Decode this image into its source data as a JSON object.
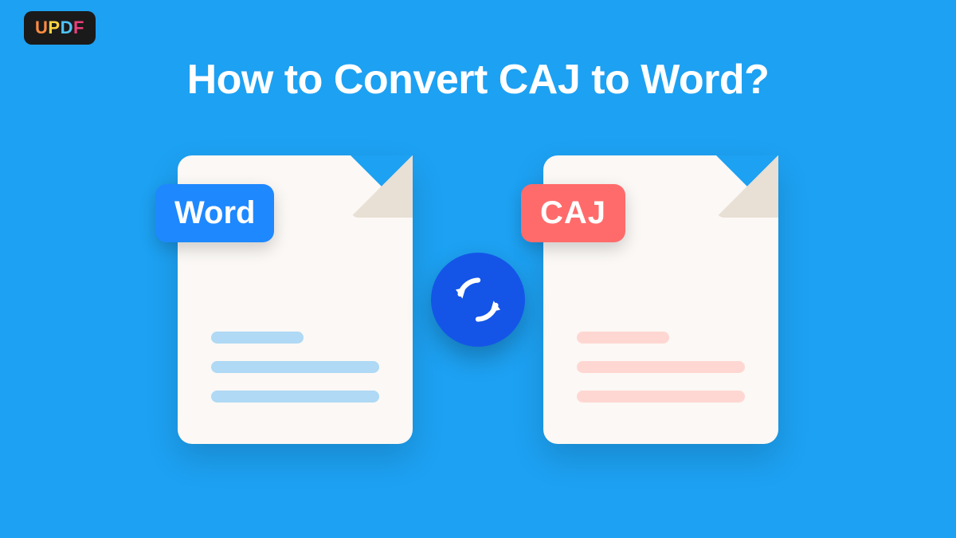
{
  "logo": {
    "u": "U",
    "p": "P",
    "d": "D",
    "f": "F"
  },
  "headline": "How to Convert CAJ to Word?",
  "formats": {
    "word": "Word",
    "caj": "CAJ"
  },
  "colors": {
    "background": "#1DA1F2",
    "word_badge": "#1E88FF",
    "caj_badge": "#FF6B6B",
    "convert_button": "#1455E8"
  }
}
